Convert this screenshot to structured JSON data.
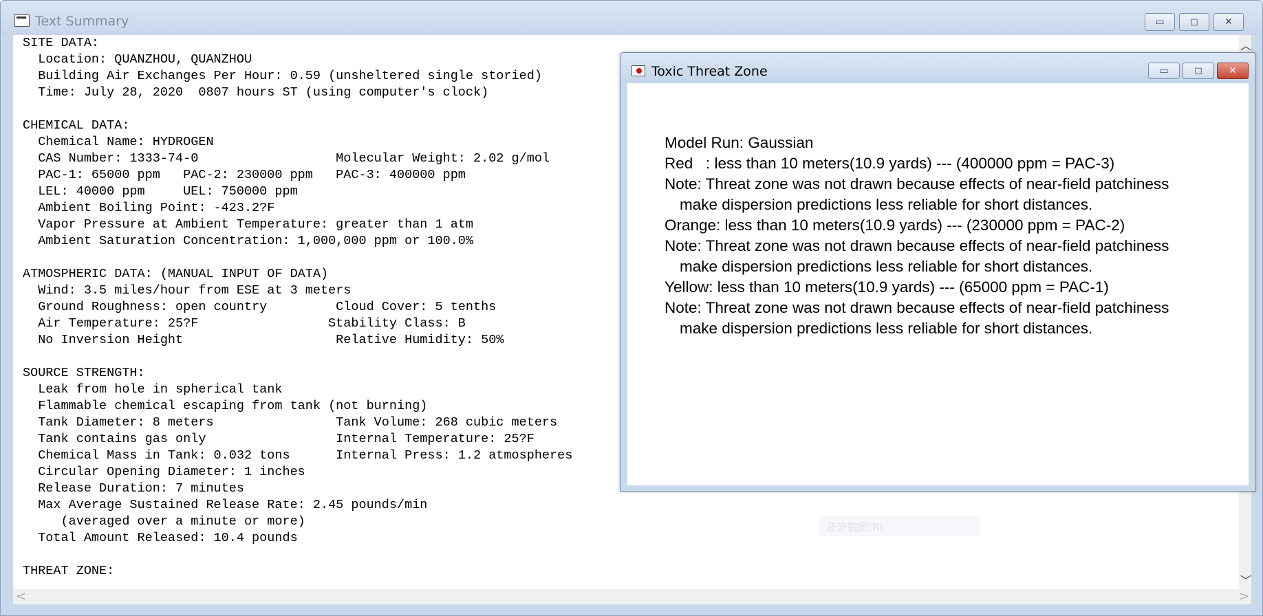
{
  "main_window": {
    "title": "Text Summary",
    "controls": {
      "minimize": "▭",
      "maximize": "◻",
      "close": "✕"
    },
    "summary_lines": [
      "SITE DATA:",
      "  Location: QUANZHOU, QUANZHOU",
      "  Building Air Exchanges Per Hour: 0.59 (unsheltered single storied)",
      "  Time: July 28, 2020  0807 hours ST (using computer's clock)",
      "",
      "CHEMICAL DATA:",
      "  Chemical Name: HYDROGEN",
      "  CAS Number: 1333-74-0                  Molecular Weight: 2.02 g/mol",
      "  PAC-1: 65000 ppm   PAC-2: 230000 ppm   PAC-3: 400000 ppm",
      "  LEL: 40000 ppm     UEL: 750000 ppm",
      "  Ambient Boiling Point: -423.2?F",
      "  Vapor Pressure at Ambient Temperature: greater than 1 atm",
      "  Ambient Saturation Concentration: 1,000,000 ppm or 100.0%",
      "",
      "ATMOSPHERIC DATA: (MANUAL INPUT OF DATA)",
      "  Wind: 3.5 miles/hour from ESE at 3 meters",
      "  Ground Roughness: open country         Cloud Cover: 5 tenths",
      "  Air Temperature: 25?F                 Stability Class: B",
      "  No Inversion Height                    Relative Humidity: 50%",
      "",
      "SOURCE STRENGTH:",
      "  Leak from hole in spherical tank",
      "  Flammable chemical escaping from tank (not burning)",
      "  Tank Diameter: 8 meters                Tank Volume: 268 cubic meters",
      "  Tank contains gas only                 Internal Temperature: 25?F",
      "  Chemical Mass in Tank: 0.032 tons      Internal Press: 1.2 atmospheres",
      "  Circular Opening Diameter: 1 inches",
      "  Release Duration: 7 minutes",
      "  Max Average Sustained Release Rate: 2.45 pounds/min",
      "     (averaged over a minute or more)",
      "  Total Amount Released: 10.4 pounds",
      "",
      "THREAT ZONE:"
    ],
    "scrollbars": {
      "up": "︿",
      "down": "﹀",
      "left": "<",
      "right": ">"
    }
  },
  "tooltip_ghost": "还原截图(R)",
  "threat_window": {
    "title": "Toxic Threat Zone",
    "controls": {
      "minimize": "▭",
      "maximize": "◻",
      "close": "✕"
    },
    "lines": [
      {
        "text": "Model Run: Gaussian",
        "indent": false
      },
      {
        "text": "Red   : less than 10 meters(10.9 yards) --- (400000 ppm = PAC-3)",
        "indent": false
      },
      {
        "text": "Note: Threat zone was not drawn because effects of near-field patchiness",
        "indent": false
      },
      {
        "text": "make dispersion predictions less reliable for short distances.",
        "indent": true
      },
      {
        "text": "Orange: less than 10 meters(10.9 yards) --- (230000 ppm = PAC-2)",
        "indent": false
      },
      {
        "text": "Note: Threat zone was not drawn because effects of near-field patchiness",
        "indent": false
      },
      {
        "text": "make dispersion predictions less reliable for short distances.",
        "indent": true
      },
      {
        "text": "Yellow: less than 10 meters(10.9 yards) --- (65000 ppm = PAC-1)",
        "indent": false
      },
      {
        "text": "Note: Threat zone was not drawn because effects of near-field patchiness",
        "indent": false
      },
      {
        "text": "make dispersion predictions less reliable for short distances.",
        "indent": true
      }
    ]
  }
}
